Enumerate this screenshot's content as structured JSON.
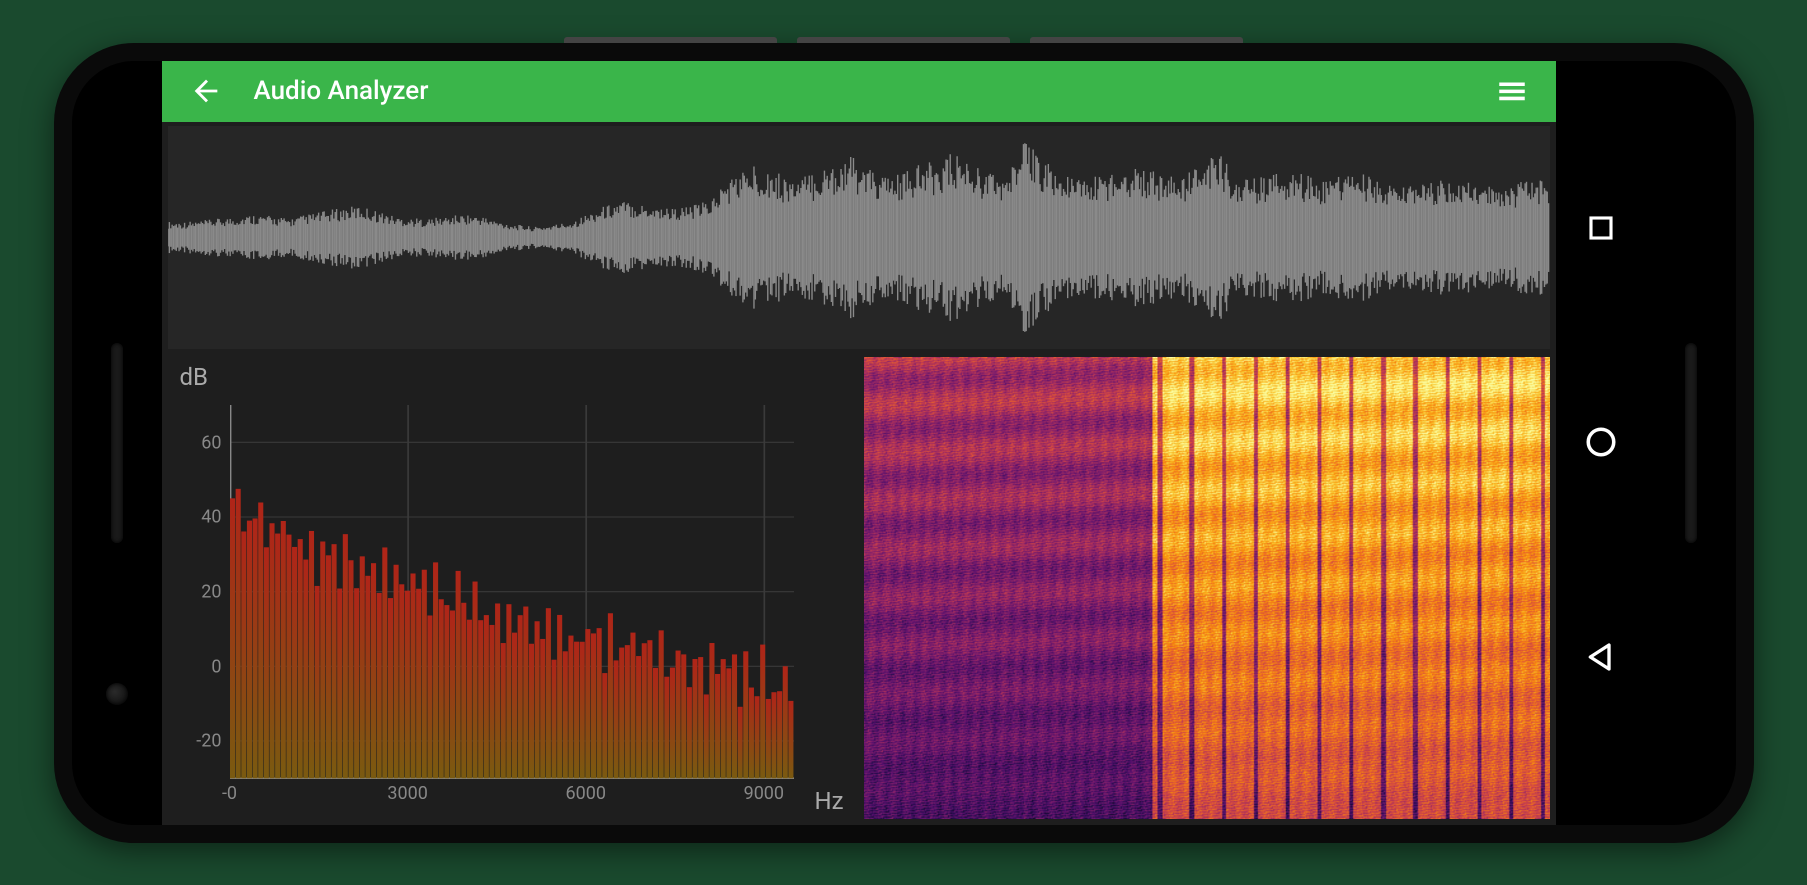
{
  "appbar": {
    "title": "Audio Analyzer",
    "back_icon": "arrow-back",
    "menu_icon": "menu"
  },
  "navbar": {
    "recents_icon": "square",
    "home_icon": "circle",
    "back_icon": "triangle"
  },
  "chart_data": {
    "spectrum": {
      "type": "bar",
      "title": "",
      "ylabel": "dB",
      "xlabel": "Hz",
      "ylim": [
        -30,
        70
      ],
      "xlim": [
        0,
        9500
      ],
      "y_ticks": [
        60,
        40,
        20,
        0,
        -20
      ],
      "x_ticks": [
        0,
        3000,
        6000,
        9000
      ],
      "x_tick_labels": [
        "-0",
        "3000",
        "6000",
        "9000"
      ],
      "approx_values_db": [
        48,
        45,
        42,
        40,
        44,
        41,
        38,
        36,
        40,
        37,
        44,
        35,
        33,
        36,
        34,
        30,
        32,
        35,
        30,
        28,
        33,
        31,
        29,
        32,
        30,
        26,
        28,
        30,
        25,
        27,
        30,
        24,
        22,
        26,
        23,
        20,
        25,
        22,
        18,
        20,
        24,
        19,
        16,
        22,
        18,
        15,
        20,
        17,
        14,
        19,
        16,
        12,
        18,
        14,
        10,
        16,
        13,
        9,
        15,
        12,
        8,
        14,
        11,
        7,
        13,
        10,
        6,
        12,
        9,
        5,
        11,
        8,
        4,
        10,
        7,
        3,
        9,
        6,
        2,
        8,
        5,
        1,
        7,
        4,
        0,
        6,
        3,
        -1,
        5,
        2,
        -2,
        4,
        1,
        -3,
        3,
        0,
        -4,
        2,
        -1,
        -5
      ]
    },
    "waveform": {
      "type": "line",
      "note": "time-domain amplitude display",
      "approx_amplitude_envelope": [
        0.15,
        0.15,
        0.16,
        0.18,
        0.2,
        0.22,
        0.2,
        0.18,
        0.22,
        0.25,
        0.28,
        0.3,
        0.25,
        0.2,
        0.18,
        0.18,
        0.2,
        0.22,
        0.2,
        0.15,
        0.12,
        0.1,
        0.12,
        0.15,
        0.22,
        0.3,
        0.35,
        0.32,
        0.3,
        0.28,
        0.3,
        0.35,
        0.55,
        0.65,
        0.7,
        0.6,
        0.55,
        0.62,
        0.7,
        0.78,
        0.65,
        0.58,
        0.6,
        0.68,
        0.72,
        0.8,
        0.7,
        0.62,
        0.58,
        0.9,
        0.78,
        0.6,
        0.55,
        0.58,
        0.62,
        0.68,
        0.65,
        0.6,
        0.55,
        0.7,
        0.82,
        0.6,
        0.55,
        0.58,
        0.62,
        0.6,
        0.55,
        0.58,
        0.62,
        0.55,
        0.5,
        0.48,
        0.5,
        0.55,
        0.52,
        0.5,
        0.48,
        0.5,
        0.55,
        0.58
      ]
    },
    "spectrogram": {
      "type": "heatmap",
      "note": "time vs frequency intensity, inferno colormap",
      "colormap": "inferno"
    }
  },
  "colors": {
    "accent": "#3ab54a",
    "background": "#1e1e1e",
    "panel": "#262626",
    "waveform": "#8a8a8a",
    "spectrum_bar_top": "#b02418",
    "spectrum_bar_bottom": "#7a5a10",
    "grid": "#3a3a3a",
    "text": "#aaaaaa"
  }
}
